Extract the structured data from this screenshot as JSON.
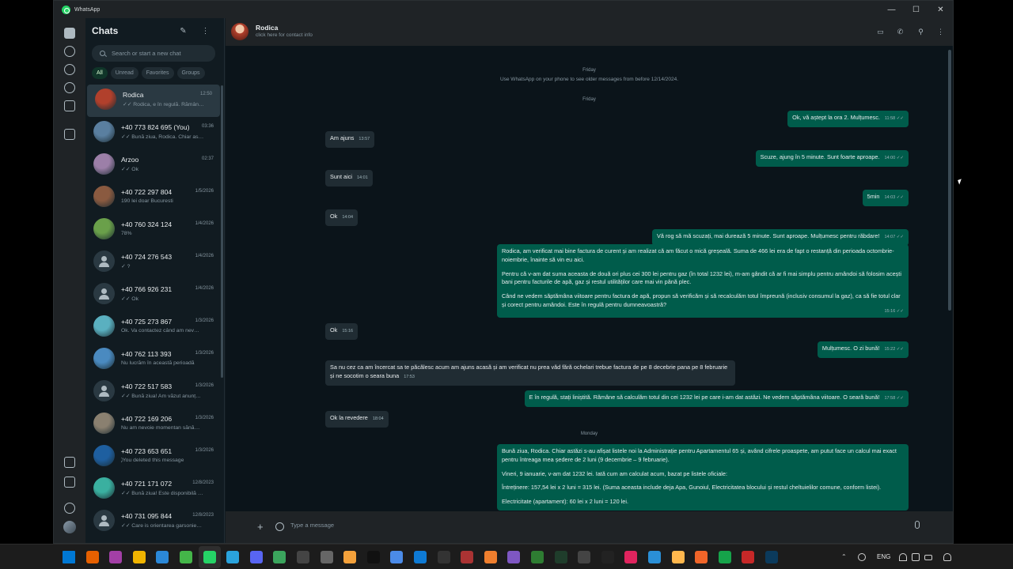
{
  "window": {
    "app_title": "WhatsApp",
    "minimize": "—",
    "maximize": "☐",
    "close": "✕"
  },
  "sidebar": {
    "title": "Chats",
    "new_chat_icon": "new-chat-icon",
    "menu_icon": "menu-icon",
    "search_placeholder": "Search or start a new chat",
    "filters": [
      "All",
      "Unread",
      "Favorites",
      "Groups"
    ],
    "chats": [
      {
        "name": "Rodica",
        "time": "12:50",
        "preview": "✓✓ Rodica, e în regulă. Rămân…",
        "avatar_color": "#b1402c"
      },
      {
        "name": "+40 773 824 695 (You)",
        "time": "03:36",
        "preview": "✓✓ Bună ziua, Rodica. Chiar as…",
        "avatar_color": "#5a7fa0"
      },
      {
        "name": "Arzoo",
        "time": "02:37",
        "preview": "✓✓ Ok",
        "avatar_color": "#9c7fa8"
      },
      {
        "name": "+40 722 297 804",
        "time": "1/5/2026",
        "preview": "190 lei doar Bucuresti",
        "avatar_color": "#8a5a40"
      },
      {
        "name": "+40 760 324 124",
        "time": "1/4/2026",
        "preview": "78%",
        "avatar_color": "#6aa04a"
      },
      {
        "name": "+40 724 276 543",
        "time": "1/4/2026",
        "preview": "✓ ?",
        "avatar_color": ""
      },
      {
        "name": "+40 766 926 231",
        "time": "1/4/2026",
        "preview": "✓✓ Ok",
        "avatar_color": ""
      },
      {
        "name": "+40 725 273 867",
        "time": "1/3/2026",
        "preview": "Ok. Va contactez când am nev…",
        "avatar_color": "#5ab0c0"
      },
      {
        "name": "+40 762 113 393",
        "time": "1/3/2026",
        "preview": "Nu lucrăm în această perioadă",
        "avatar_color": "#4a8ac0"
      },
      {
        "name": "+40 722 517 583",
        "time": "1/3/2026",
        "preview": "✓✓ Bună ziua! Am văzut anunț…",
        "avatar_color": ""
      },
      {
        "name": "+40 722 169 206",
        "time": "1/3/2026",
        "preview": "Nu am nevoie momentan sănă…",
        "avatar_color": "#8a8070"
      },
      {
        "name": "+40 723 653 651",
        "time": "1/3/2026",
        "preview": "⃠ You deleted this message",
        "avatar_color": "#1e5fa0"
      },
      {
        "name": "+40 721 171 072",
        "time": "12/8/2023",
        "preview": "✓✓ Bună ziua! Este disponibilă …",
        "avatar_color": "#3ab0a0"
      },
      {
        "name": "+40 731 095 844",
        "time": "12/8/2023",
        "preview": "✓✓ Care is orientarea garsonie…",
        "avatar_color": ""
      }
    ]
  },
  "conversation": {
    "contact_name": "Rodica",
    "contact_sub": "click here for contact info",
    "day_friday_1": "Friday",
    "system_note": "Use WhatsApp on your phone to see older messages from before 12/14/2024.",
    "day_friday_2": "Friday",
    "day_monday": "Monday",
    "messages": [
      {
        "dir": "out",
        "text": "Ok, vă aștept la ora 2. Mulțumesc.",
        "time": "11:58 ✓✓"
      },
      {
        "dir": "in",
        "text": "Am ajuns",
        "time": "13:57"
      },
      {
        "dir": "out",
        "text": "Scuze, ajung în 5 minute. Sunt foarte aproape.",
        "time": "14:00 ✓✓"
      },
      {
        "dir": "in",
        "text": "Sunt aici",
        "time": "14:01"
      },
      {
        "dir": "out",
        "text": "5min",
        "time": "14:03 ✓✓"
      },
      {
        "dir": "in",
        "text": "Ok",
        "time": "14:04"
      },
      {
        "dir": "out",
        "text": "Vă rog să mă scuzați, mai durează 5 minute. Sunt aproape. Mulțumesc pentru răbdare!",
        "time": "14:07 ✓✓"
      },
      {
        "dir": "out",
        "paragraphs": [
          "Rodica, am verificat mai bine factura de curent și am realizat că am făcut o mică greșeală. Suma de 466 lei era de fapt o restanță din perioada octombrie-noiembrie, înainte să vin eu aici.",
          "Pentru că v-am dat suma aceasta de două ori plus cei 300 lei pentru gaz (în total 1232 lei), m-am gândit că ar fi mai simplu pentru amândoi să folosim acești bani pentru facturile de apă, gaz și restul utilităților care mai vin până plec.",
          "Când ne vedem săptămâna viitoare pentru factura de apă, propun să verificăm și să recalculăm totul împreună (inclusiv consumul la gaz), ca să fie totul clar și corect pentru amândoi. Este în regulă pentru dumneavoastră?"
        ],
        "time": "15:16 ✓✓"
      },
      {
        "dir": "in",
        "text": "Ok",
        "time": "15:16"
      },
      {
        "dir": "out",
        "text": "Mulțumesc. O zi bună!",
        "time": "15:22 ✓✓"
      },
      {
        "dir": "in",
        "text": "Sa nu cez ca am încercat sa te păcălesc acum am ajuns acasă și am verificat nu prea văd fără ochelari trebue factura de pe 8 decebrie pana pe 8 februarie și ne socotim o seara buna",
        "time": "17:53"
      },
      {
        "dir": "out",
        "text": "E în regulă, stați liniștită. Rămâne să calculăm totul din cei 1232 lei pe care i-am dat astăzi. Ne vedem săptămâna viitoare. O seară bună!",
        "time": "17:58 ✓✓"
      },
      {
        "dir": "in",
        "text": "Ok la revedere",
        "time": "18:04"
      },
      {
        "dir": "out",
        "paragraphs": [
          "Bună ziua, Rodica. Chiar astăzi s-au afișat listele noi la Administrație pentru Apartamentul 65 și, având cifrele proaspete, am putut face un calcul mai exact pentru întreaga mea ședere de 2 luni (9 decembrie – 9 februarie).",
          "Vineri, 9 ianuarie, v-am dat 1232 lei. Iată cum am calculat acum, bazat pe listele oficiale:",
          "   Întreținere: 157,54 lei x 2 luni = 315 lei. (Suma aceasta include deja Apa, Gunoiul, Electricitatea blocului și restul cheltuielilor comune, conform listei).",
          "   Electricitate (apartament): 60 lei x 2 luni = 120 lei."
        ],
        "time": ""
      }
    ],
    "composer_placeholder": "Type a message"
  },
  "taskbar": {
    "language": "ENG",
    "icon_colors": [
      "#0078d4",
      "#e66000",
      "#a33fa6",
      "#f0b400",
      "#2b88d8",
      "#44b649",
      "#25d366",
      "#2aa3dd",
      "#5865f2",
      "#3ba55d",
      "#444",
      "#666",
      "#f4a13b",
      "#111",
      "#4b8be8",
      "#0e7ad4",
      "#333",
      "#a33",
      "#f07f2e",
      "#7e57c2",
      "#2e7d32",
      "#1f3d2b",
      "#444",
      "#222",
      "#e0245e",
      "#2a8fd6",
      "#ffb74d",
      "#f06529",
      "#16a34a",
      "#c62828",
      "#0b3a5c"
    ],
    "accent": "#25d366",
    "bubble_out": "#005c4b",
    "bubble_in": "#202c33"
  }
}
